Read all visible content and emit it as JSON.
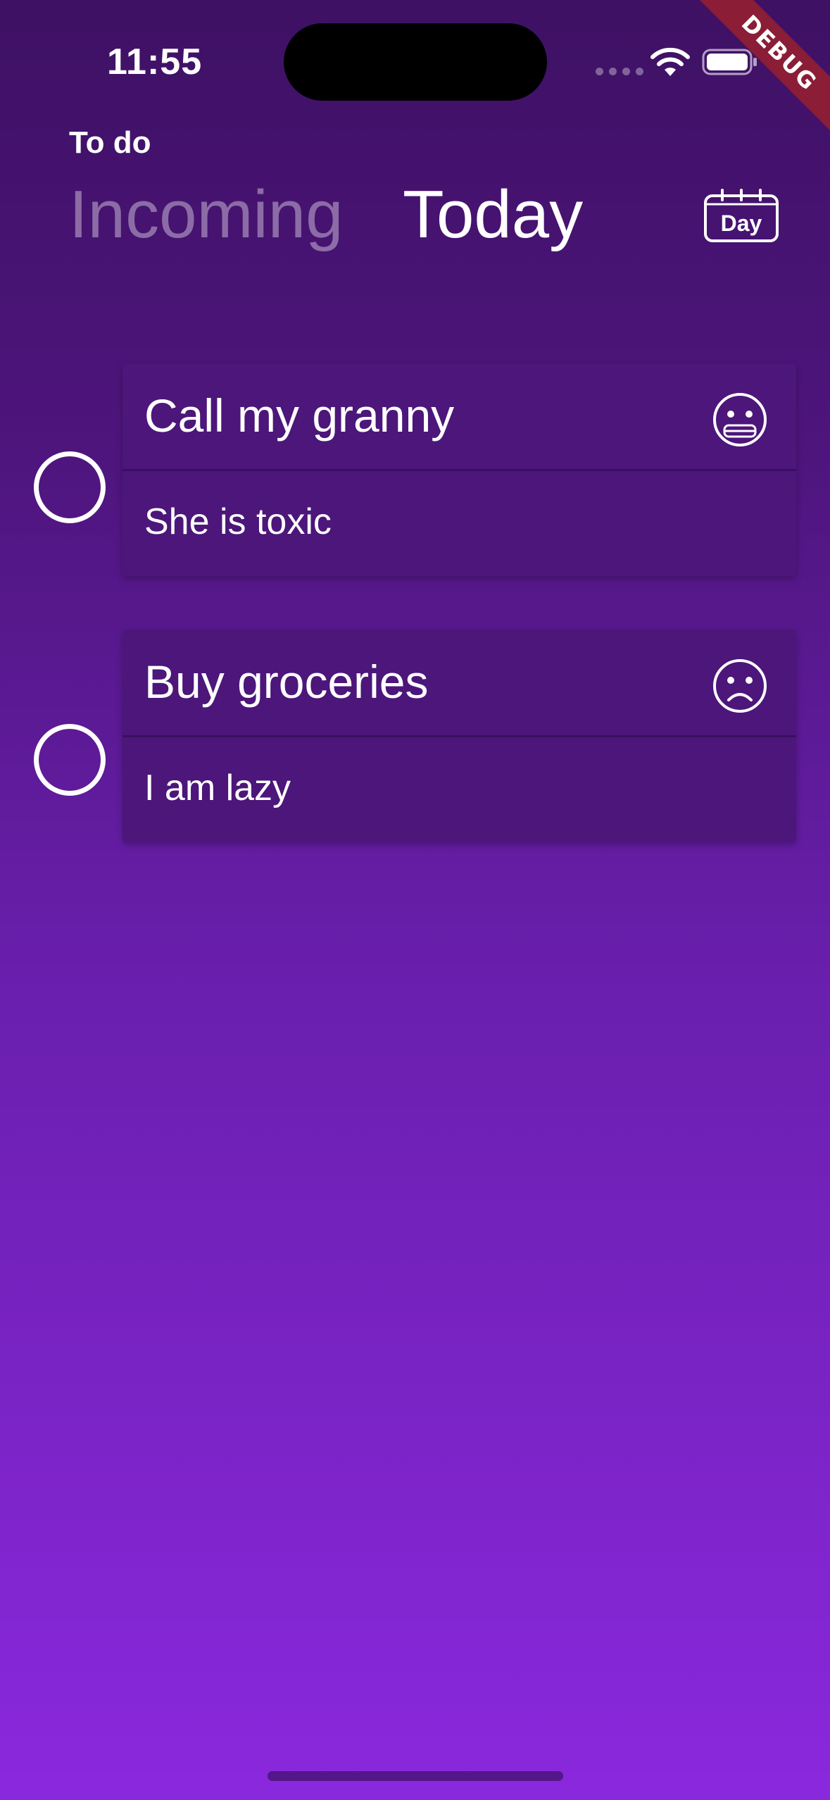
{
  "status_bar": {
    "time": "11:55"
  },
  "debug_banner": {
    "label": "DEBUG"
  },
  "header": {
    "app_title": "To do",
    "tabs": [
      {
        "label": "Incoming",
        "active": false
      },
      {
        "label": "Today",
        "active": true
      }
    ],
    "day_button_label": "Day"
  },
  "tasks": [
    {
      "title": "Call my granny",
      "note": "She is toxic",
      "mood_icon": "grimacing-face-icon"
    },
    {
      "title": "Buy groceries",
      "note": "I am lazy",
      "mood_icon": "sad-face-icon"
    }
  ],
  "colors": {
    "gradient_top": "#3e1164",
    "gradient_bottom": "#8a28dd",
    "card": "#4c167a",
    "debug_ribbon": "#8b1d36"
  }
}
